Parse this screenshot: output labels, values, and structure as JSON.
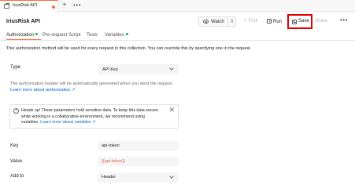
{
  "tab": {
    "label": "IriusRisk API",
    "unsaved_indicator_color": "#ff6c37",
    "add_label": "+",
    "more_label": "•••"
  },
  "header": {
    "title": "IriusRisk API",
    "watch_label": "Watch",
    "watch_count": "0",
    "fork_label": "Fork",
    "run_label": "Run",
    "save_label": "Save",
    "share_label": "Share",
    "more_label": "•••",
    "highlight_color": "#e10000"
  },
  "subtabs": [
    {
      "label": "Authorization",
      "dot": true
    },
    {
      "label": "Pre-request Script",
      "dot": false
    },
    {
      "label": "Tests",
      "dot": false
    },
    {
      "label": "Variables",
      "dot": true
    }
  ],
  "intro": "This authorization method will be used for every request in this collection. You can override this by specifying one in the request.",
  "type": {
    "label": "Type",
    "value": "API Key"
  },
  "auth_note": "The authorization header will be automatically generated when you send the request.",
  "learn_link": "Learn more about authorization ↗",
  "callout": {
    "text": "Heads up! These parameters hold sensitive data. To keep this data secure while working in a collaborative environment, we recommend using variables.",
    "link": "Learn more about variables ↗",
    "close_label": "✕"
  },
  "fields": {
    "key": {
      "label": "Key",
      "value": "api-token"
    },
    "value": {
      "label": "Value",
      "value": "{{api-token}}"
    },
    "add_to": {
      "label": "Add to",
      "value": "Header"
    }
  }
}
